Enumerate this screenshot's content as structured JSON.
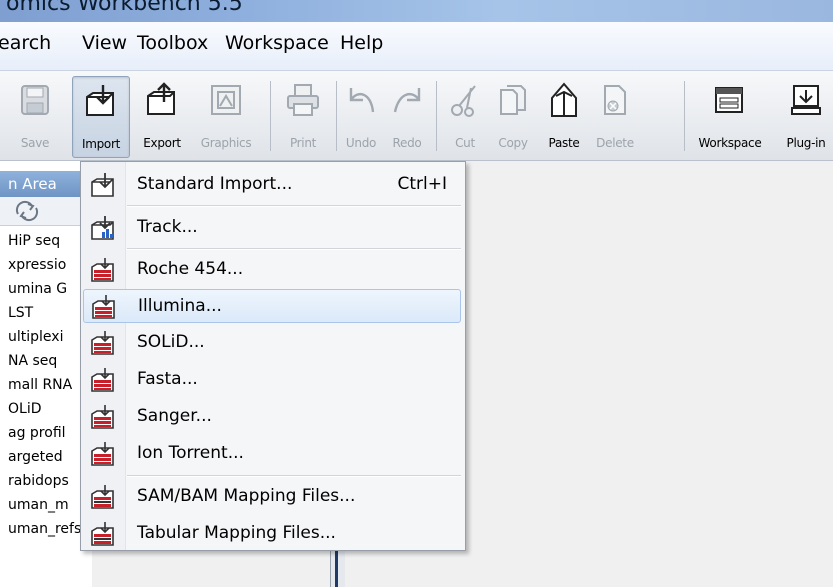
{
  "window": {
    "title": "omics Workbench 5.5"
  },
  "menubar": {
    "items": [
      "earch",
      "View",
      "Toolbox",
      "Workspace",
      "Help"
    ]
  },
  "toolbar": {
    "buttons": [
      {
        "label": "Save",
        "enabled": false,
        "icon": "save-icon"
      },
      {
        "label": "Import",
        "enabled": true,
        "icon": "import-icon"
      },
      {
        "label": "Export",
        "enabled": true,
        "icon": "export-icon"
      },
      {
        "label": "Graphics",
        "enabled": false,
        "icon": "graphics-icon"
      },
      {
        "label": "Print",
        "enabled": false,
        "icon": "print-icon"
      },
      {
        "label": "Undo",
        "enabled": false,
        "icon": "undo-icon"
      },
      {
        "label": "Redo",
        "enabled": false,
        "icon": "redo-icon"
      },
      {
        "label": "Cut",
        "enabled": false,
        "icon": "cut-icon"
      },
      {
        "label": "Copy",
        "enabled": false,
        "icon": "copy-icon"
      },
      {
        "label": "Paste",
        "enabled": true,
        "icon": "paste-icon"
      },
      {
        "label": "Delete",
        "enabled": false,
        "icon": "delete-icon"
      },
      {
        "label": "Workspace",
        "enabled": true,
        "icon": "workspace-icon"
      },
      {
        "label": "Plug-in",
        "enabled": true,
        "icon": "plugin-icon"
      }
    ]
  },
  "navigation": {
    "header": "n Area",
    "items": [
      "HiP seq",
      "xpressio",
      "umina G",
      "LST",
      "ultiplexi",
      "NA seq",
      "mall RNA",
      "OLiD",
      "ag profil",
      "argeted",
      "rabidops",
      "uman_m",
      "uman_refseq"
    ]
  },
  "import_menu": {
    "items": [
      {
        "label": "Standard Import...",
        "shortcut": "Ctrl+I",
        "icon": "standard-import-icon"
      },
      {
        "label": "Track...",
        "shortcut": "",
        "icon": "track-import-icon"
      },
      {
        "label": "Roche 454...",
        "shortcut": "",
        "icon": "ngs-import-icon"
      },
      {
        "label": "Illumina...",
        "shortcut": "",
        "icon": "ngs-import-icon"
      },
      {
        "label": "SOLiD...",
        "shortcut": "",
        "icon": "ngs-import-icon"
      },
      {
        "label": "Fasta...",
        "shortcut": "",
        "icon": "ngs-import-icon"
      },
      {
        "label": "Sanger...",
        "shortcut": "",
        "icon": "ngs-import-icon"
      },
      {
        "label": "Ion Torrent...",
        "shortcut": "",
        "icon": "ngs-import-icon"
      },
      {
        "label": "SAM/BAM Mapping Files...",
        "shortcut": "",
        "icon": "mapping-import-icon"
      },
      {
        "label": "Tabular Mapping Files...",
        "shortcut": "",
        "icon": "mapping-import-icon"
      }
    ],
    "highlighted": "Illumina..."
  },
  "colors": {
    "title_bar": "#8fb0de",
    "menu_highlight": "#dbe9f9",
    "nav_header": "#6f94c4",
    "import_red": "#c8202a"
  }
}
